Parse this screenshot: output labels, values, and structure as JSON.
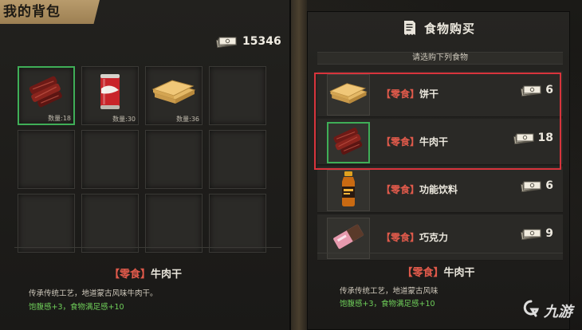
{
  "bag": {
    "title": "我的背包",
    "currency": "15346",
    "slots": [
      {
        "item": "beef-jerky",
        "qty": "数量:18",
        "selected": true
      },
      {
        "item": "soda-can",
        "qty": "数量:30",
        "selected": false
      },
      {
        "item": "biscuit",
        "qty": "数量:36",
        "selected": false
      },
      {
        "item": "",
        "qty": "",
        "selected": false
      },
      {
        "item": "",
        "qty": "",
        "selected": false
      },
      {
        "item": "",
        "qty": "",
        "selected": false
      },
      {
        "item": "",
        "qty": "",
        "selected": false
      },
      {
        "item": "",
        "qty": "",
        "selected": false
      },
      {
        "item": "",
        "qty": "",
        "selected": false
      },
      {
        "item": "",
        "qty": "",
        "selected": false
      },
      {
        "item": "",
        "qty": "",
        "selected": false
      },
      {
        "item": "",
        "qty": "",
        "selected": false
      }
    ],
    "detail": {
      "tag": "【零食】",
      "name": "牛肉干",
      "desc": "传承传统工艺，地道蒙古风味牛肉干。",
      "effect": "饱腹感+3，食物满足感+10"
    }
  },
  "shop": {
    "title": "食物购买",
    "subtitle": "请选购下列食物",
    "items": [
      {
        "tag": "【零食】",
        "name": "饼干",
        "price": "6",
        "art": "biscuit",
        "selected": false
      },
      {
        "tag": "【零食】",
        "name": "牛肉干",
        "price": "18",
        "art": "beef-jerky",
        "selected": true
      },
      {
        "tag": "【零食】",
        "name": "功能饮料",
        "price": "6",
        "art": "energy-drink",
        "selected": false
      },
      {
        "tag": "【零食】",
        "name": "巧克力",
        "price": "9",
        "art": "chocolate",
        "selected": false
      }
    ],
    "detail": {
      "tag": "【零食】",
      "name": "牛肉干",
      "desc": "传承传统工艺，地道蒙古风味",
      "effect": "饱腹感+3，食物满足感+10"
    }
  },
  "watermark": "九游",
  "colors": {
    "selected_border": "#3fae57",
    "highlight_box": "#d8343c",
    "tag_red": "#e15a4b",
    "effect_green": "#6fcf5a",
    "title_tab": "#b89b6c"
  },
  "icons": {
    "currency": "cash-stack-icon",
    "shop": "receipt-icon",
    "watermark": "jiuyou-logo-icon"
  }
}
